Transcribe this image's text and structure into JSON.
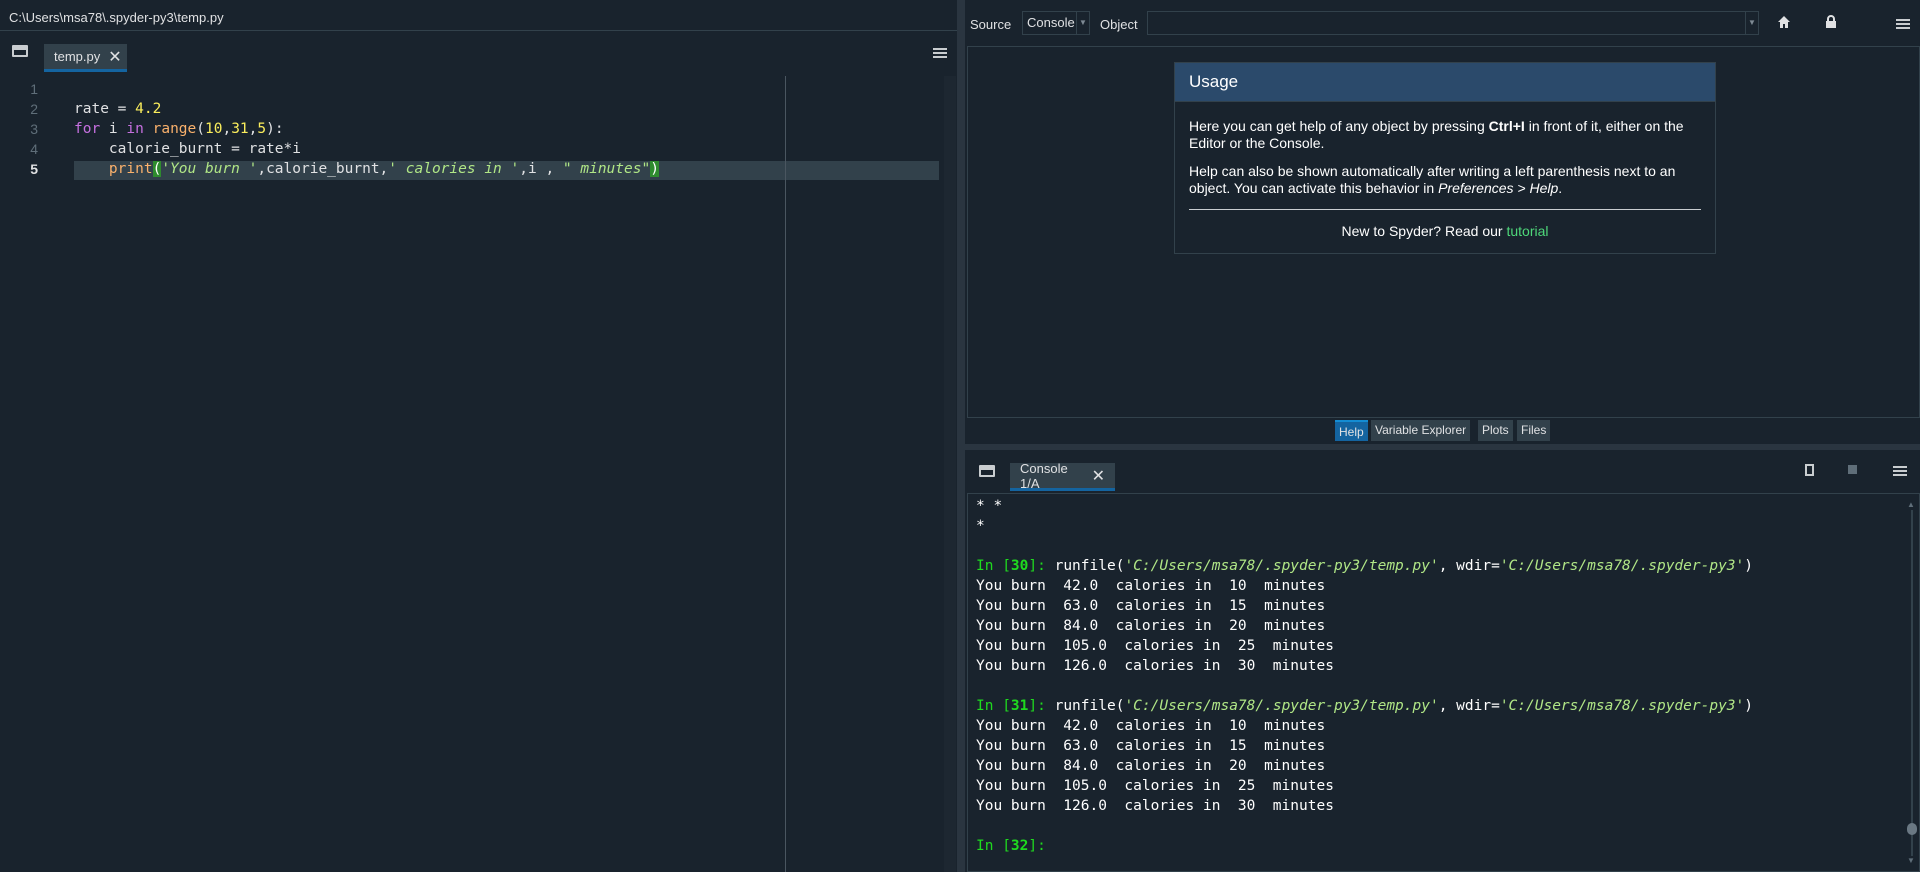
{
  "editor": {
    "path": "C:\\Users\\msa78\\.spyder-py3\\temp.py",
    "tab_label": "temp.py",
    "line_numbers": [
      "1",
      "2",
      "3",
      "4",
      "5"
    ],
    "current_line": "5",
    "lines": {
      "l2": {
        "a": "rate = ",
        "b": "4.2"
      },
      "l3": {
        "kw1": "for",
        "a": " i ",
        "kw2": "in",
        "b": " ",
        "bi": "range",
        "c": "(",
        "n1": "10",
        "d": ",",
        "n2": "31",
        "e": ",",
        "n3": "5",
        "f": "):"
      },
      "l4": {
        "a": "    calorie_burnt = rate*i"
      },
      "l5": {
        "indent": "    ",
        "bi": "print",
        "p1": "(",
        "s1": "'You burn '",
        "a": ",calorie_burnt,",
        "s2": "' calories in '",
        "b": ",i , ",
        "s3": "\" minutes\"",
        "p2": ")"
      }
    }
  },
  "help": {
    "source_label": "Source",
    "source_value": "Console",
    "object_label": "Object",
    "object_value": "",
    "usage_title": "Usage",
    "p1_a": "Here you can get help of any object by pressing ",
    "p1_b": "Ctrl+I",
    "p1_c": " in front of it, either on the Editor or the Console.",
    "p2_a": "Help can also be shown automatically after writing a left parenthesis next to an object. You can activate this behavior in ",
    "p2_b": "Preferences > Help",
    "p2_c": ".",
    "footer_a": "New to Spyder? Read our ",
    "footer_link": "tutorial",
    "tabs": [
      "Help",
      "Variable Explorer",
      "Plots",
      "Files"
    ]
  },
  "console": {
    "tab_label": "Console 1/A",
    "lines": [
      {
        "type": "text",
        "text": "* *"
      },
      {
        "type": "text",
        "text": "*"
      },
      {
        "type": "blank",
        "text": ""
      },
      {
        "type": "in",
        "prompt_a": "In [",
        "num": "30",
        "prompt_b": "]: ",
        "cmd": "runfile(",
        "s1": "'C:/Users/msa78/.spyder-py3/temp.py'",
        "mid": ", wdir=",
        "s2": "'C:/Users/msa78/.spyder-py3'",
        "end": ")"
      },
      {
        "type": "text",
        "text": "You burn  42.0  calories in  10  minutes"
      },
      {
        "type": "text",
        "text": "You burn  63.0  calories in  15  minutes"
      },
      {
        "type": "text",
        "text": "You burn  84.0  calories in  20  minutes"
      },
      {
        "type": "text",
        "text": "You burn  105.0  calories in  25  minutes"
      },
      {
        "type": "text",
        "text": "You burn  126.0  calories in  30  minutes"
      },
      {
        "type": "blank",
        "text": ""
      },
      {
        "type": "in",
        "prompt_a": "In [",
        "num": "31",
        "prompt_b": "]: ",
        "cmd": "runfile(",
        "s1": "'C:/Users/msa78/.spyder-py3/temp.py'",
        "mid": ", wdir=",
        "s2": "'C:/Users/msa78/.spyder-py3'",
        "end": ")"
      },
      {
        "type": "text",
        "text": "You burn  42.0  calories in  10  minutes"
      },
      {
        "type": "text",
        "text": "You burn  63.0  calories in  15  minutes"
      },
      {
        "type": "text",
        "text": "You burn  84.0  calories in  20  minutes"
      },
      {
        "type": "text",
        "text": "You burn  105.0  calories in  25  minutes"
      },
      {
        "type": "text",
        "text": "You burn  126.0  calories in  30  minutes"
      },
      {
        "type": "blank",
        "text": ""
      },
      {
        "type": "in",
        "prompt_a": "In [",
        "num": "32",
        "prompt_b": "]: ",
        "cmd": "",
        "s1": "",
        "mid": "",
        "s2": "",
        "end": ""
      }
    ]
  },
  "icons": {
    "undock": "undock-icon",
    "close": "close-icon",
    "options": "menu-icon",
    "home": "home-icon",
    "lock": "lock-icon",
    "copy": "copy-icon",
    "stop": "stop-icon"
  }
}
